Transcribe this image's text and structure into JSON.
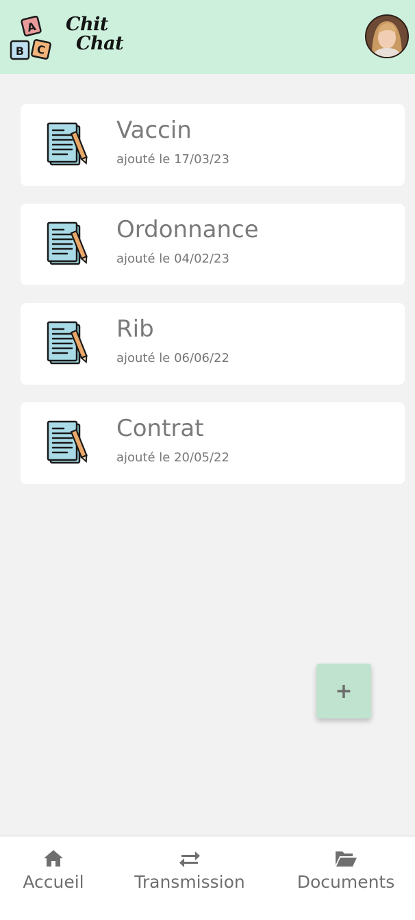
{
  "app": {
    "name_line1": "Chit",
    "name_line2": "Chat",
    "logo_letters": [
      "A",
      "B",
      "C"
    ]
  },
  "documents": [
    {
      "title": "Vaccin",
      "date": "ajouté le 17/03/23",
      "icon": "document-pen-icon"
    },
    {
      "title": "Ordonnance",
      "date": "ajouté le 04/02/23",
      "icon": "document-pen-icon"
    },
    {
      "title": "Rib",
      "date": "ajouté le 06/06/22",
      "icon": "document-pen-icon"
    },
    {
      "title": "Contrat",
      "date": "ajouté le 20/05/22",
      "icon": "document-pen-icon"
    }
  ],
  "fab": {
    "label": "+"
  },
  "nav": [
    {
      "label": "Accueil",
      "icon": "home-icon"
    },
    {
      "label": "Transmission",
      "icon": "transfer-arrows-icon"
    },
    {
      "label": "Documents",
      "icon": "folder-open-icon"
    }
  ],
  "colors": {
    "header_bg": "#cdf0dd",
    "page_bg": "#f3f2f2",
    "fab_bg": "#bfe3cf",
    "text_gray": "#7a7a7a"
  }
}
